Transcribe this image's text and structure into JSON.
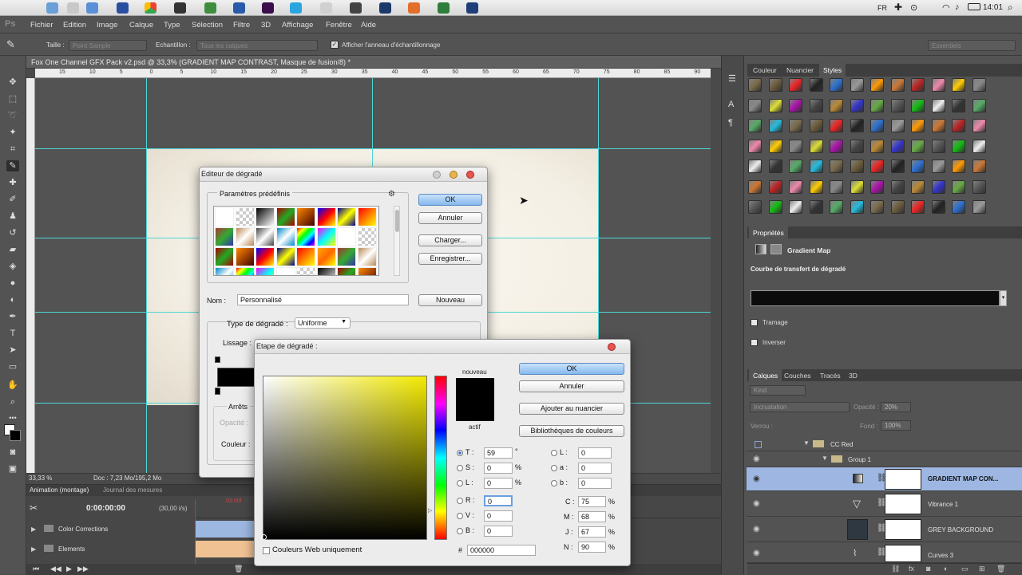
{
  "mac_menubar": {
    "lang": "FR",
    "time": "14:01"
  },
  "menu": {
    "logo": "Ps",
    "items": [
      "Fichier",
      "Edition",
      "Image",
      "Calque",
      "Type",
      "Sélection",
      "Filtre",
      "3D",
      "Affichage",
      "Fenêtre",
      "Aide"
    ]
  },
  "options_bar": {
    "size_label": "Taille :",
    "size_value": "Point Sample",
    "sample_label": "Echantillon :",
    "sample_value": "Tous les calques",
    "ring_label": "Afficher l'anneau d'échantillonnage",
    "workspace": "Essentiels"
  },
  "document": {
    "tab_title": "Fox One Channel GFX Pack v2.psd @ 33,3% (GRADIENT MAP CONTRAST, Masque de fusion/8) *",
    "ruler_ticks": [
      "15",
      "10",
      "5",
      "0",
      "5",
      "10",
      "15",
      "20",
      "25",
      "30",
      "35",
      "40",
      "45",
      "50",
      "55",
      "60",
      "65",
      "70",
      "75",
      "80",
      "85",
      "90"
    ],
    "zoom": "33,33 %",
    "doc_info": "Doc : 7,23 Mo/195,2 Mo"
  },
  "animation": {
    "tabs": [
      "Animation (montage)",
      "Journal des mesures"
    ],
    "timecode": "0:00:00:00",
    "fps": "(30,00 i/s)",
    "marker": "02:00f",
    "tracks": [
      "Color Corrections",
      "Elements"
    ]
  },
  "swatches_panel": {
    "tabs": [
      "Couleur",
      "Nuancier",
      "Styles"
    ]
  },
  "properties": {
    "tab": "Propriétés",
    "title": "Gradient Map",
    "curve_label": "Courbe de transfert de dégradé",
    "dither": "Tramage",
    "reverse": "Inverser"
  },
  "layers_panel": {
    "tabs": [
      "Calques",
      "Couches",
      "Tracés",
      "3D"
    ],
    "kind": "Kind",
    "blend_mode": "Incrustation",
    "opacity_label": "Opacité :",
    "opacity": "20%",
    "lock_label": "Verrou :",
    "fill_label": "Fond :",
    "fill": "100%",
    "layers": [
      {
        "name": "CC Red",
        "type": "group"
      },
      {
        "name": "Group 1",
        "type": "group"
      },
      {
        "name": "GRADIENT MAP CON...",
        "type": "adjustment",
        "selected": true
      },
      {
        "name": "Vibrance 1",
        "type": "adjustment"
      },
      {
        "name": "GREY BACKGROUND",
        "type": "layer"
      },
      {
        "name": "Curves 3",
        "type": "adjustment"
      }
    ]
  },
  "gradient_editor": {
    "title": "Editeur de dégradé",
    "presets_label": "Paramètres prédéfinis",
    "ok": "OK",
    "cancel": "Annuler",
    "load": "Charger...",
    "save": "Enregistrer...",
    "name_label": "Nom :",
    "name_value": "Personnalisé",
    "new": "Nouveau",
    "type_label": "Type de dégradé :",
    "type_value": "Uniforme",
    "smooth_label": "Lissage :",
    "stops_label": "Arrêts",
    "opacity_label": "Opacité :",
    "color_label": "Couleur :"
  },
  "color_picker": {
    "title": "Etape de dégradé :",
    "new_label": "nouveau",
    "current_label": "actif",
    "ok": "OK",
    "cancel": "Annuler",
    "add_swatch": "Ajouter au nuancier",
    "libraries": "Bibliothèques de couleurs",
    "web_only": "Couleurs Web uniquement",
    "hsb": [
      {
        "k": "T :",
        "v": "59",
        "u": "°"
      },
      {
        "k": "S :",
        "v": "0",
        "u": "%"
      },
      {
        "k": "L :",
        "v": "0",
        "u": "%"
      }
    ],
    "rgb": [
      {
        "k": "R :",
        "v": "0"
      },
      {
        "k": "V :",
        "v": "0"
      },
      {
        "k": "B :",
        "v": "0"
      }
    ],
    "lab": [
      {
        "k": "L :",
        "v": "0"
      },
      {
        "k": "a :",
        "v": "0"
      },
      {
        "k": "b :",
        "v": "0"
      }
    ],
    "cmyk": [
      {
        "k": "C :",
        "v": "75",
        "u": "%"
      },
      {
        "k": "M :",
        "v": "68",
        "u": "%"
      },
      {
        "k": "J :",
        "v": "67",
        "u": "%"
      },
      {
        "k": "N :",
        "v": "90",
        "u": "%"
      }
    ],
    "hex_label": "#",
    "hex": "000000"
  }
}
